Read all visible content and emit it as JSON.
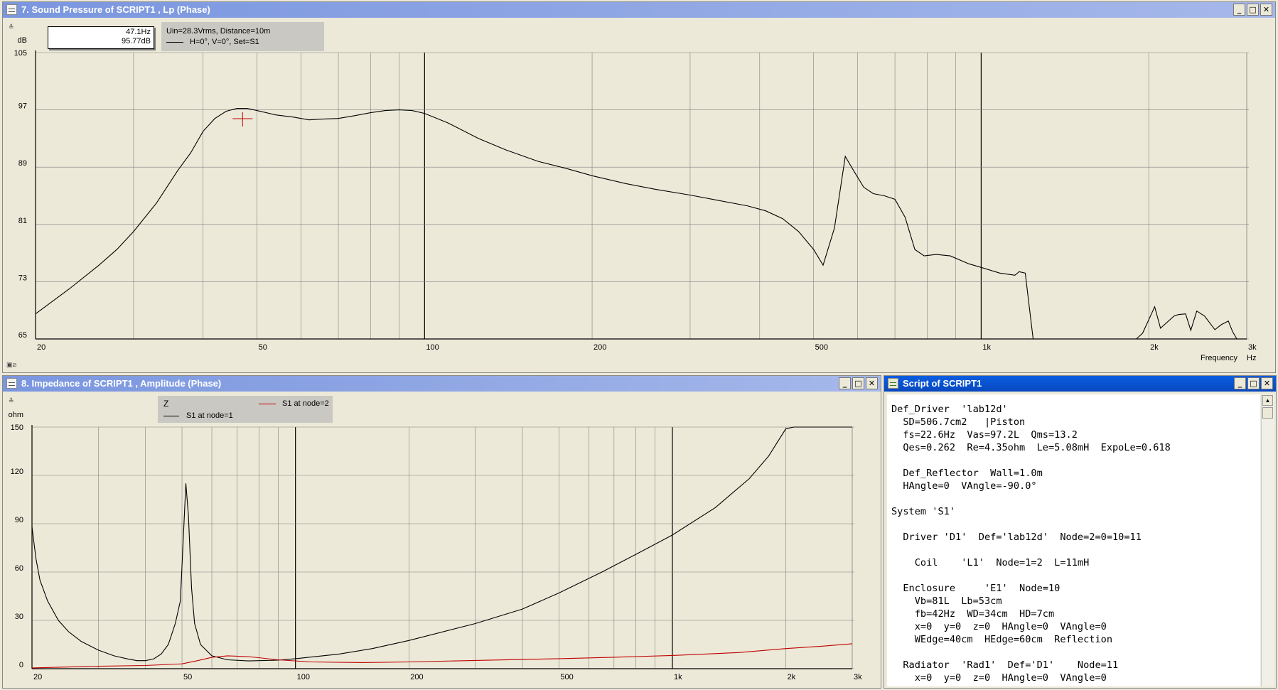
{
  "window_sp": {
    "title": "7. Sound Pressure of SCRIPT1 , Lp (Phase)",
    "cursor": {
      "freq": "47.1Hz",
      "level": "95.77dB"
    },
    "info": {
      "line1": "Uin=28.3Vrms, Distance=10m",
      "line2": "H=0°, V=0°, Set=S1"
    }
  },
  "window_imp": {
    "title": "8. Impedance of SCRIPT1 , Amplitude (Phase)",
    "legend": {
      "title": "Z",
      "series1": "S1 at node=1",
      "series2": "S1 at node=2"
    }
  },
  "window_script": {
    "title": "Script of SCRIPT1",
    "lines": [
      "Def_Driver  'lab12d'",
      "  SD=506.7cm2   |Piston",
      "  fs=22.6Hz  Vas=97.2L  Qms=13.2",
      "  Qes=0.262  Re=4.35ohm  Le=5.08mH  ExpoLe=0.618",
      "",
      "  Def_Reflector  Wall=1.0m",
      "  HAngle=0  VAngle=-90.0°",
      "",
      "System 'S1'",
      "",
      "  Driver 'D1'  Def='lab12d'  Node=2=0=10=11",
      "",
      "    Coil    'L1'  Node=1=2  L=11mH",
      "",
      "  Enclosure     'E1'  Node=10",
      "    Vb=81L  Lb=53cm",
      "    fb=42Hz  WD=34cm  HD=7cm",
      "    x=0  y=0  z=0  HAngle=0  VAngle=0",
      "    WEdge=40cm  HEdge=60cm  Reflection",
      "",
      "  Radiator  'Rad1'  Def='D1'    Node=11",
      "    x=0  y=0  z=0  HAngle=0  VAngle=0"
    ]
  },
  "icons": {
    "minimize": "minimize-icon",
    "maximize": "maximize-icon",
    "close": "close-icon"
  },
  "glyphs": {
    "minimize": "_",
    "maximize": "□",
    "close": "✕"
  },
  "colors": {
    "curve_black": "#000000",
    "curve_red": "#c00000",
    "cursor_mark": "#c00000",
    "active_title": "#0a5ee0"
  },
  "chart_data": [
    {
      "type": "line",
      "x_scale": "log",
      "xlabel": "Frequency",
      "xunit": "Hz",
      "ylabel": "dB",
      "xlim": [
        20,
        3000
      ],
      "ylim": [
        65,
        105
      ],
      "x_ticks": [
        20,
        50,
        100,
        200,
        500,
        1000,
        2000,
        3000
      ],
      "x_tick_labels": [
        "20",
        "50",
        "100",
        "200",
        "500",
        "1k",
        "2k",
        "3k"
      ],
      "y_ticks": [
        65,
        73,
        81,
        89,
        97,
        105
      ],
      "y_tick_labels": [
        "65",
        "73",
        "81",
        "89",
        "97",
        "105"
      ],
      "grid": true,
      "cursor": {
        "x": 47.1,
        "y": 95.77
      },
      "series": [
        {
          "color": "#000000",
          "points": [
            [
              20,
              68.5
            ],
            [
              23,
              72
            ],
            [
              26,
              75.3
            ],
            [
              28,
              77.5
            ],
            [
              30,
              80
            ],
            [
              33,
              84
            ],
            [
              36,
              88.5
            ],
            [
              38,
              91
            ],
            [
              40,
              94
            ],
            [
              42,
              95.8
            ],
            [
              44,
              96.8
            ],
            [
              46,
              97.2
            ],
            [
              48,
              97.2
            ],
            [
              50,
              96.9
            ],
            [
              54,
              96.3
            ],
            [
              58,
              96.0
            ],
            [
              62,
              95.6
            ],
            [
              65,
              95.7
            ],
            [
              70,
              95.8
            ],
            [
              75,
              96.2
            ],
            [
              80,
              96.6
            ],
            [
              85,
              96.9
            ],
            [
              90,
              97.0
            ],
            [
              95,
              96.9
            ],
            [
              100,
              96.5
            ],
            [
              110,
              95.2
            ],
            [
              125,
              93
            ],
            [
              140,
              91.4
            ],
            [
              160,
              89.8
            ],
            [
              180,
              88.8
            ],
            [
              200,
              87.8
            ],
            [
              230,
              86.7
            ],
            [
              260,
              85.9
            ],
            [
              300,
              85.1
            ],
            [
              340,
              84.3
            ],
            [
              380,
              83.6
            ],
            [
              410,
              82.9
            ],
            [
              440,
              81.8
            ],
            [
              470,
              80.0
            ],
            [
              500,
              77.5
            ],
            [
              520,
              75.3
            ],
            [
              545,
              80.5
            ],
            [
              570,
              90.5
            ],
            [
              590,
              88.5
            ],
            [
              615,
              86.2
            ],
            [
              640,
              85.3
            ],
            [
              670,
              85.0
            ],
            [
              700,
              84.5
            ],
            [
              730,
              82.0
            ],
            [
              760,
              77.5
            ],
            [
              790,
              76.6
            ],
            [
              830,
              76.8
            ],
            [
              880,
              76.6
            ],
            [
              950,
              75.5
            ],
            [
              1000,
              75.0
            ],
            [
              1080,
              74.2
            ],
            [
              1150,
              73.9
            ],
            [
              1170,
              74.4
            ],
            [
              1200,
              74.2
            ],
            [
              1240,
              65
            ],
            [
              1500,
              65
            ],
            [
              1900,
              65
            ],
            [
              1950,
              65.8
            ],
            [
              2050,
              69.5
            ],
            [
              2100,
              66.5
            ],
            [
              2220,
              68.2
            ],
            [
              2260,
              68.4
            ],
            [
              2330,
              68.5
            ],
            [
              2380,
              66.2
            ],
            [
              2440,
              68.9
            ],
            [
              2520,
              68.2
            ],
            [
              2630,
              66.3
            ],
            [
              2700,
              67
            ],
            [
              2780,
              67.5
            ],
            [
              2830,
              66
            ],
            [
              2880,
              65
            ],
            [
              3000,
              65
            ]
          ]
        }
      ]
    },
    {
      "type": "line",
      "x_scale": "log",
      "ylabel": "ohm",
      "xlim": [
        20,
        3000
      ],
      "ylim": [
        0,
        150
      ],
      "x_ticks": [
        20,
        50,
        100,
        200,
        500,
        1000,
        2000,
        3000
      ],
      "x_tick_labels": [
        "20",
        "50",
        "100",
        "200",
        "500",
        "1k",
        "2k",
        "3k"
      ],
      "y_ticks": [
        0,
        30,
        60,
        90,
        120,
        150
      ],
      "y_tick_labels": [
        "0",
        "30",
        "60",
        "90",
        "120",
        "150"
      ],
      "grid": true,
      "series": [
        {
          "name": "S1 at node=1",
          "color": "#000000",
          "points": [
            [
              20,
              88
            ],
            [
              20.5,
              68
            ],
            [
              21,
              55
            ],
            [
              22,
              42
            ],
            [
              23.5,
              30
            ],
            [
              25,
              23
            ],
            [
              27,
              17
            ],
            [
              30,
              11.5
            ],
            [
              33,
              8
            ],
            [
              36,
              6
            ],
            [
              38,
              5
            ],
            [
              40,
              5
            ],
            [
              42,
              6
            ],
            [
              44,
              9
            ],
            [
              46,
              15
            ],
            [
              48,
              28
            ],
            [
              49.5,
              42
            ],
            [
              50.5,
              85
            ],
            [
              51.2,
              115
            ],
            [
              52,
              95
            ],
            [
              53,
              50
            ],
            [
              54,
              28
            ],
            [
              56,
              15
            ],
            [
              60,
              8
            ],
            [
              66,
              5.5
            ],
            [
              75,
              4.8
            ],
            [
              90,
              5.3
            ],
            [
              100,
              6.2
            ],
            [
              130,
              9
            ],
            [
              160,
              12.5
            ],
            [
              200,
              17.5
            ],
            [
              300,
              28
            ],
            [
              400,
              37
            ],
            [
              500,
              47
            ],
            [
              650,
              60
            ],
            [
              800,
              71
            ],
            [
              1000,
              83
            ],
            [
              1300,
              100
            ],
            [
              1600,
              118
            ],
            [
              1800,
              132
            ],
            [
              2000,
              149
            ],
            [
              2100,
              150
            ],
            [
              3000,
              150
            ]
          ]
        },
        {
          "name": "S1 at node=2",
          "color": "#c00000",
          "points": [
            [
              20,
              0.5
            ],
            [
              30,
              1.5
            ],
            [
              40,
              2
            ],
            [
              50,
              3
            ],
            [
              55,
              5
            ],
            [
              60,
              7
            ],
            [
              66,
              8
            ],
            [
              75,
              7.5
            ],
            [
              90,
              5.5
            ],
            [
              110,
              4.2
            ],
            [
              150,
              3.8
            ],
            [
              200,
              4.2
            ],
            [
              300,
              5.1
            ],
            [
              500,
              6.2
            ],
            [
              700,
              7.1
            ],
            [
              1000,
              8.2
            ],
            [
              1500,
              10
            ],
            [
              2000,
              12.5
            ],
            [
              2500,
              14
            ],
            [
              3000,
              15.5
            ]
          ]
        }
      ]
    }
  ]
}
